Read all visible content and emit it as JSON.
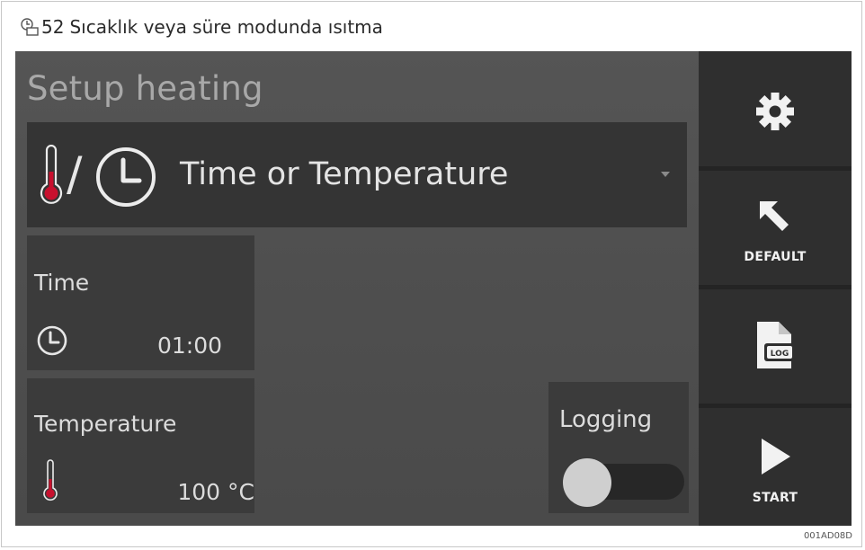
{
  "figure": {
    "number": "52",
    "caption": "Sıcaklık veya süre modunda ısıtma",
    "code": "001AD08D"
  },
  "screen": {
    "title": "Setup heating",
    "mode": {
      "label": "Time or Temperature",
      "separator": "/",
      "icons": [
        "thermometer-icon",
        "clock-icon",
        "dropdown-caret-icon"
      ]
    },
    "time": {
      "label": "Time",
      "value": "01:00",
      "icon": "clock-icon"
    },
    "temperature": {
      "label": "Temperature",
      "value": "100 °C",
      "icon": "thermometer-icon"
    },
    "logging": {
      "label": "Logging",
      "enabled": false
    }
  },
  "sidebar": {
    "buttons": [
      {
        "id": "settings",
        "label": "",
        "icon": "gear-icon"
      },
      {
        "id": "default",
        "label": "DEFAULT",
        "icon": "reset-arrow-icon"
      },
      {
        "id": "log",
        "label": "",
        "icon": "log-file-icon",
        "icon_text": "LOG"
      },
      {
        "id": "start",
        "label": "START",
        "icon": "play-icon"
      }
    ]
  },
  "colors": {
    "background": "#4d4d4d",
    "panel": "#3b3b3b",
    "sidebar": "#2f2f2f",
    "thermometer_fill": "#c8102e",
    "text": "#dcdcdc"
  }
}
